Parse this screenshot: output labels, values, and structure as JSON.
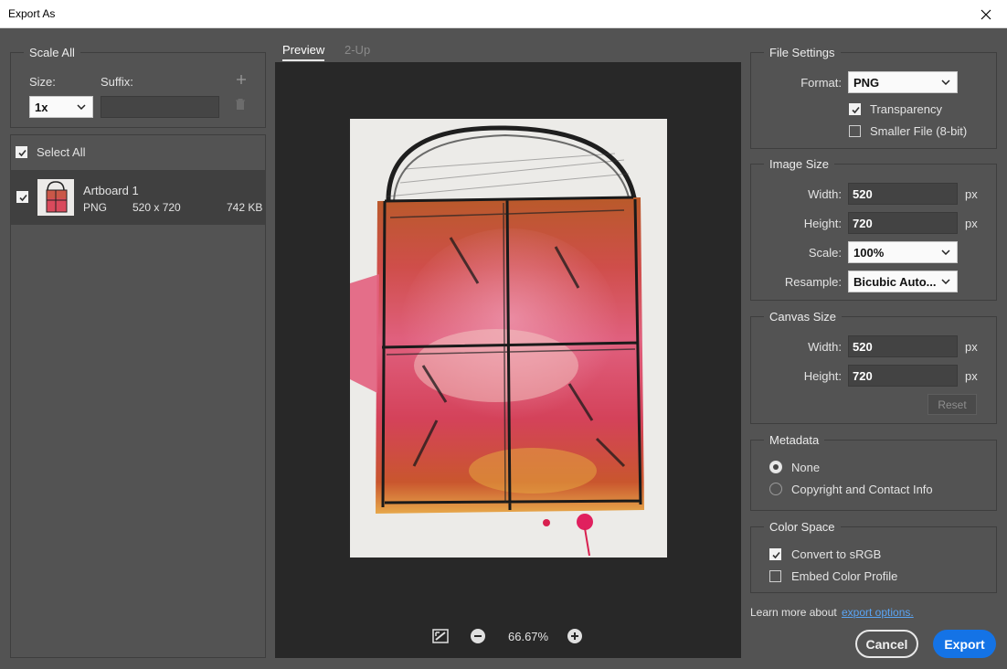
{
  "window": {
    "title": "Export As"
  },
  "left": {
    "scale_all_label": "Scale All",
    "size_label": "Size:",
    "suffix_label": "Suffix:",
    "size_value": "1x",
    "suffix_value": "",
    "select_all_label": "Select All",
    "select_all_checked": true,
    "artboard": {
      "name": "Artboard 1",
      "format": "PNG",
      "dimensions": "520 x 720",
      "file_size": "742 KB",
      "checked": true
    }
  },
  "center": {
    "tabs": [
      {
        "label": "Preview",
        "active": true
      },
      {
        "label": "2-Up",
        "active": false
      }
    ],
    "zoom": "66.67%"
  },
  "file_settings": {
    "label": "File Settings",
    "format_label": "Format:",
    "format_value": "PNG",
    "transparency_label": "Transparency",
    "transparency_checked": true,
    "smaller_label": "Smaller File (8-bit)",
    "smaller_checked": false
  },
  "image_size": {
    "label": "Image Size",
    "width_label": "Width:",
    "width_value": "520",
    "width_unit": "px",
    "height_label": "Height:",
    "height_value": "720",
    "height_unit": "px",
    "scale_label": "Scale:",
    "scale_value": "100%",
    "resample_label": "Resample:",
    "resample_value": "Bicubic Auto..."
  },
  "canvas_size": {
    "label": "Canvas Size",
    "width_label": "Width:",
    "width_value": "520",
    "width_unit": "px",
    "height_label": "Height:",
    "height_value": "720",
    "height_unit": "px",
    "reset_label": "Reset"
  },
  "metadata": {
    "label": "Metadata",
    "options": [
      {
        "label": "None",
        "selected": true
      },
      {
        "label": "Copyright and Contact Info",
        "selected": false
      }
    ]
  },
  "color_space": {
    "label": "Color Space",
    "convert_label": "Convert to sRGB",
    "convert_checked": true,
    "embed_label": "Embed Color Profile",
    "embed_checked": false
  },
  "footer": {
    "learn_text": "Learn more about",
    "learn_link": "export options.",
    "cancel_label": "Cancel",
    "export_label": "Export"
  },
  "colors": {
    "accent": "#1473e6",
    "link": "#5aa5f5",
    "preview_bg": "#282828",
    "panel_bg": "#535353"
  }
}
